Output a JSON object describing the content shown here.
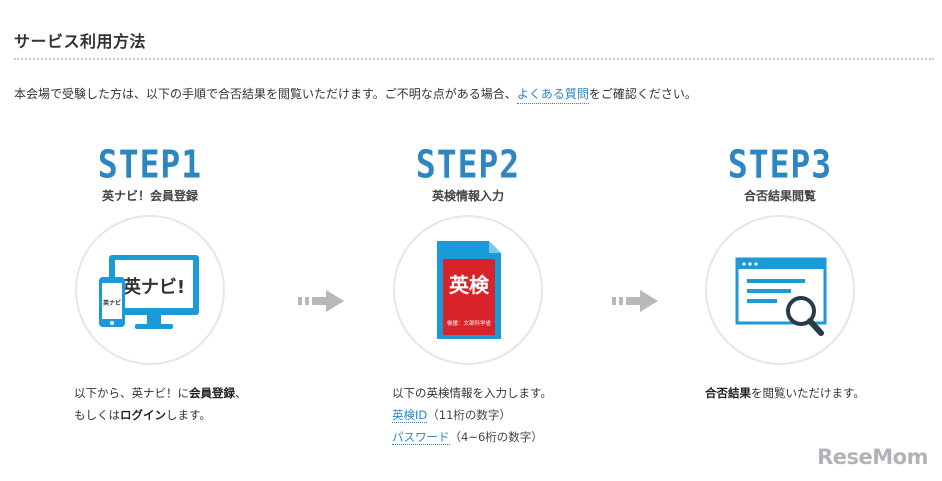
{
  "section": {
    "title": "サービス利用方法",
    "intro_before": "本会場で受験した方は、以下の手順で合否結果を閲覧いただけます。ご不明な点がある場合、",
    "intro_link": "よくある質問",
    "intro_after": "をご確認ください。"
  },
  "steps": [
    {
      "label": "STEP1",
      "title": "英ナビ！会員登録",
      "icon": "devices-eigonavi-icon",
      "icon_text": "英ナビ!",
      "icon_small_text": "英ナビ",
      "desc_line1_a": "以下から、英ナビ！に",
      "desc_line1_b": "会員登録",
      "desc_line1_c": "、",
      "desc_line2_a": "もしくは",
      "desc_line2_b": "ログイン",
      "desc_line2_c": "します。"
    },
    {
      "label": "STEP2",
      "title": "英検情報入力",
      "icon": "eiken-document-icon",
      "icon_text": "英検",
      "icon_small_text": "後援：文部科学省",
      "desc_line1": "以下の英検情報を入力します。",
      "item1_link": "英検ID",
      "item1_note": "（11桁の数字）",
      "item2_link": "パスワード",
      "item2_note": "（4~6桁の数字）"
    },
    {
      "label": "STEP3",
      "title": "合否結果閲覧",
      "icon": "browser-search-icon",
      "desc_bold": "合否結果",
      "desc_rest": "を閲覧いただけます。"
    }
  ],
  "watermark": "ReseMom",
  "colors": {
    "accent": "#2e86c1",
    "icon_blue": "#1a9ad6",
    "eiken_red": "#d8232a",
    "arrow_gray": "#b8b8b8",
    "circle_border": "#e6e6e6"
  }
}
